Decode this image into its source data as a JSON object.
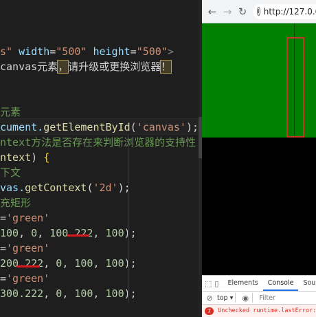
{
  "editor": {
    "lines": [
      {
        "segments": [
          {
            "t": "s\"",
            "c": "str"
          },
          {
            "t": " ",
            "c": "plain"
          },
          {
            "t": "width",
            "c": "attr"
          },
          {
            "t": "=",
            "c": "eq"
          },
          {
            "t": "\"500\"",
            "c": "str"
          },
          {
            "t": " ",
            "c": "plain"
          },
          {
            "t": "height",
            "c": "attr"
          },
          {
            "t": "=",
            "c": "eq"
          },
          {
            "t": "\"500\"",
            "c": "str"
          },
          {
            "t": ">",
            "c": "tag"
          }
        ]
      },
      {
        "segments": [
          {
            "t": "canvas元素",
            "c": "plain"
          },
          {
            "t": "，",
            "c": "hl"
          },
          {
            "t": "请升级或更换浏览器",
            "c": "plain"
          },
          {
            "t": "！",
            "c": "hl"
          }
        ]
      },
      {
        "segments": []
      },
      {
        "segments": []
      },
      {
        "segments": [
          {
            "t": "元素",
            "c": "cmt"
          }
        ]
      },
      {
        "segments": [
          {
            "t": "cument.",
            "c": "var"
          },
          {
            "t": "getElementById",
            "c": "fn"
          },
          {
            "t": "(",
            "c": "punc"
          },
          {
            "t": "'canvas'",
            "c": "str"
          },
          {
            "t": ");",
            "c": "punc"
          }
        ]
      },
      {
        "segments": [
          {
            "t": "ntext方法是否存在来判断浏览器的支持性",
            "c": "cmt"
          }
        ]
      },
      {
        "segments": [
          {
            "t": "ntext",
            "c": "fn"
          },
          {
            "t": ") ",
            "c": "punc"
          },
          {
            "t": "{",
            "c": "brace"
          }
        ]
      },
      {
        "segments": [
          {
            "t": "下文",
            "c": "cmt"
          }
        ]
      },
      {
        "segments": [
          {
            "t": "vas.",
            "c": "var"
          },
          {
            "t": "getContext",
            "c": "fn"
          },
          {
            "t": "(",
            "c": "punc"
          },
          {
            "t": "'2d'",
            "c": "str"
          },
          {
            "t": ");",
            "c": "punc"
          }
        ]
      },
      {
        "segments": [
          {
            "t": "充矩形",
            "c": "cmt"
          }
        ]
      },
      {
        "segments": [
          {
            "t": "=",
            "c": "plain"
          },
          {
            "t": "'green'",
            "c": "str"
          }
        ]
      },
      {
        "segments": [
          {
            "t": "100",
            "c": "num"
          },
          {
            "t": ", ",
            "c": "punc"
          },
          {
            "t": "0",
            "c": "num"
          },
          {
            "t": ", ",
            "c": "punc"
          },
          {
            "t": "100.222",
            "c": "num"
          },
          {
            "t": ", ",
            "c": "punc"
          },
          {
            "t": "100",
            "c": "num"
          },
          {
            "t": ");",
            "c": "punc"
          }
        ]
      },
      {
        "segments": [
          {
            "t": "=",
            "c": "plain"
          },
          {
            "t": "'green'",
            "c": "str"
          }
        ]
      },
      {
        "segments": [
          {
            "t": "200.222",
            "c": "num"
          },
          {
            "t": ", ",
            "c": "punc"
          },
          {
            "t": "0",
            "c": "num"
          },
          {
            "t": ", ",
            "c": "punc"
          },
          {
            "t": "100",
            "c": "num"
          },
          {
            "t": ", ",
            "c": "punc"
          },
          {
            "t": "100",
            "c": "num"
          },
          {
            "t": ");",
            "c": "punc"
          }
        ]
      },
      {
        "segments": [
          {
            "t": "=",
            "c": "plain"
          },
          {
            "t": "'green'",
            "c": "str"
          }
        ]
      },
      {
        "segments": [
          {
            "t": "300.222",
            "c": "num"
          },
          {
            "t": ", ",
            "c": "punc"
          },
          {
            "t": "0",
            "c": "num"
          },
          {
            "t": ", ",
            "c": "punc"
          },
          {
            "t": "100",
            "c": "num"
          },
          {
            "t": ", ",
            "c": "punc"
          },
          {
            "t": "100",
            "c": "num"
          },
          {
            "t": ");",
            "c": "punc"
          }
        ]
      }
    ]
  },
  "browser": {
    "back_icon": "←",
    "forward_icon": "→",
    "reload_icon": "↻",
    "info_icon": "i",
    "url": "http://127.0.0.1:",
    "canvas": {
      "background_color": "#000000",
      "fill_color": "#008000",
      "seam_color": "#004d00"
    }
  },
  "devtools": {
    "tabs": [
      "Elements",
      "Console",
      "Sourc"
    ],
    "active_tab": "Console",
    "inspect_icon": "⬚",
    "device_icon": "▯",
    "clear_icon": "⊘",
    "context": "top ▾",
    "eye_icon": "◉",
    "filter_placeholder": "Filter",
    "error_count": "7",
    "error_text": "Unchecked runtime.lastError: T"
  }
}
